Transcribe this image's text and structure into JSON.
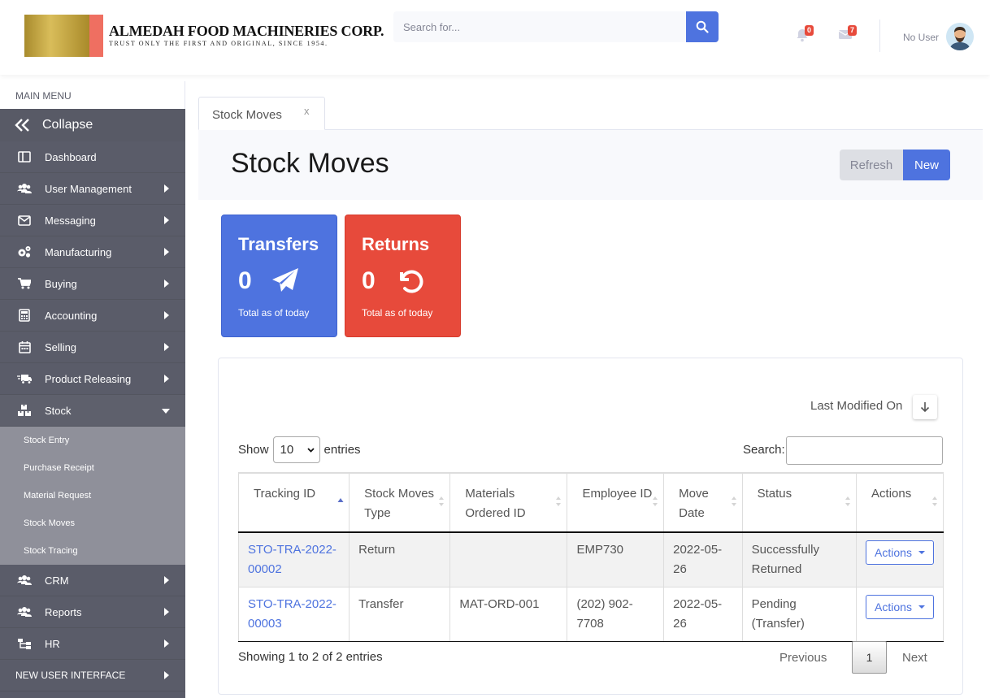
{
  "brand": {
    "name": "ALMEDAH FOOD MACHINERIES CORP.",
    "tagline": "TRUST ONLY THE FIRST AND ORIGINAL, SINCE 1954.",
    "colors": {
      "gold": "#c9a94a",
      "red": "#ef6f61"
    }
  },
  "topbar": {
    "search_placeholder": "Search for...",
    "alerts_count": "0",
    "messages_count": "7",
    "user_name": "No User"
  },
  "sidebar": {
    "heading": "MAIN MENU",
    "collapse_label": "Collapse",
    "items": [
      {
        "label": "Dashboard",
        "icon": "dashboard-icon"
      },
      {
        "label": "User Management",
        "icon": "users-cog-icon"
      },
      {
        "label": "Messaging",
        "icon": "envelope-icon"
      },
      {
        "label": "Manufacturing",
        "icon": "cogs-icon"
      },
      {
        "label": "Buying",
        "icon": "cart-icon"
      },
      {
        "label": "Accounting",
        "icon": "calculator-icon"
      },
      {
        "label": "Selling",
        "icon": "calendar-icon"
      },
      {
        "label": "Product Releasing",
        "icon": "truck-icon"
      },
      {
        "label": "Stock",
        "icon": "boxes-icon"
      }
    ],
    "stock_submenu": [
      "Stock Entry",
      "Purchase Receipt",
      "Material Request",
      "Stock Moves",
      "Stock Tracing"
    ],
    "items_after": [
      {
        "label": "CRM",
        "icon": "users-icon"
      },
      {
        "label": "Reports",
        "icon": "users-icon"
      },
      {
        "label": "HR",
        "icon": "sitemap-icon"
      }
    ],
    "new_ui_label": "NEW USER INTERFACE"
  },
  "tab": {
    "label": "Stock Moves",
    "close": "x"
  },
  "page": {
    "title": "Stock Moves",
    "refresh_label": "Refresh",
    "new_label": "New",
    "accent": "#4e73df"
  },
  "cards": [
    {
      "title": "Transfers",
      "value": "0",
      "footer": "Total as of today",
      "color": "#4e73df",
      "icon": "paper-plane-icon"
    },
    {
      "title": "Returns",
      "value": "0",
      "footer": "Total as of today",
      "color": "#e74a3b",
      "icon": "undo-icon"
    }
  ],
  "table_panel": {
    "sort_label": "Last Modified On",
    "show_label": "Show",
    "entries_label": "entries",
    "page_size": "10",
    "search_label": "Search:",
    "columns": [
      "Tracking ID",
      "Stock Moves Type",
      "Materials Ordered ID",
      "Employee ID",
      "Move Date",
      "Status",
      "Actions"
    ],
    "rows": [
      {
        "tracking_id": "STO-TRA-2022-00002",
        "type": "Return",
        "materials_id": "",
        "employee_id": "EMP730",
        "move_date": "2022-05-26",
        "status": "Successfully Returned",
        "action": "Actions"
      },
      {
        "tracking_id": "STO-TRA-2022-00003",
        "type": "Transfer",
        "materials_id": "MAT-ORD-001",
        "employee_id": "(202) 902-7708",
        "move_date": "2022-05-26",
        "status": "Pending (Transfer)",
        "action": "Actions"
      }
    ],
    "info": "Showing 1 to 2 of 2 entries",
    "previous": "Previous",
    "current_page": "1",
    "next": "Next"
  }
}
